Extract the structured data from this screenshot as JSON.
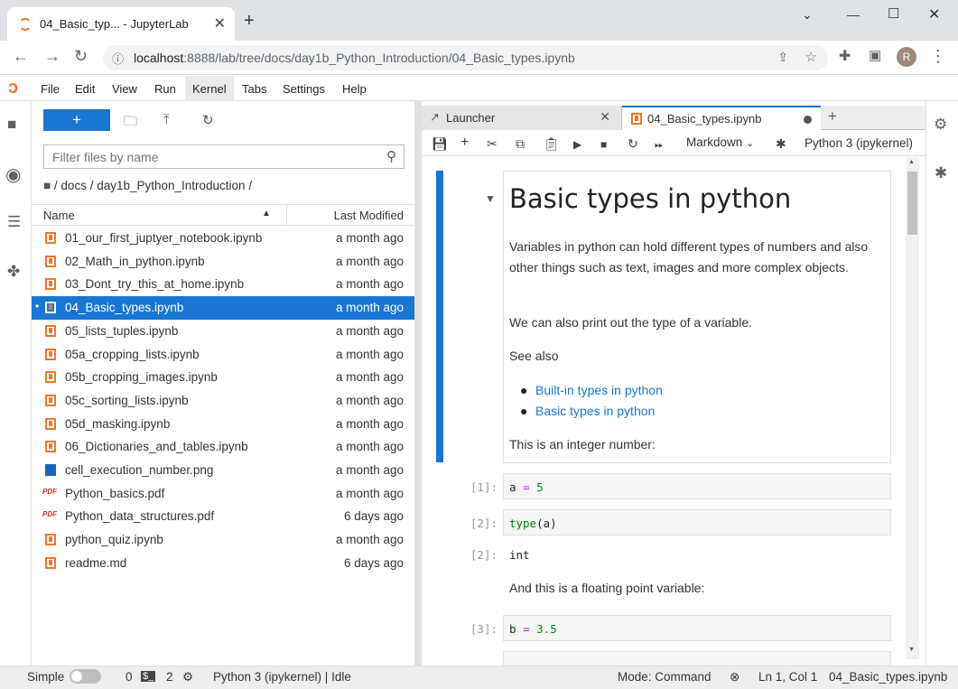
{
  "browser": {
    "tab_title": "04_Basic_typ... - JupyterLab",
    "url_host": "localhost",
    "url_rest": ":8888/lab/tree/docs/day1b_Python_Introduction/04_Basic_types.ipynb",
    "avatar": "R"
  },
  "menubar": [
    "File",
    "Edit",
    "View",
    "Run",
    "Kernel",
    "Tabs",
    "Settings",
    "Help"
  ],
  "filebrowser": {
    "filter_placeholder": "Filter files by name",
    "breadcrumb": "/ docs / day1b_Python_Introduction /",
    "col_name": "Name",
    "col_modified": "Last Modified",
    "files": [
      {
        "name": "01_our_first_juptyer_notebook.ipynb",
        "modified": "a month ago",
        "type": "notebook"
      },
      {
        "name": "02_Math_in_python.ipynb",
        "modified": "a month ago",
        "type": "notebook"
      },
      {
        "name": "03_Dont_try_this_at_home.ipynb",
        "modified": "a month ago",
        "type": "notebook"
      },
      {
        "name": "04_Basic_types.ipynb",
        "modified": "a month ago",
        "type": "notebook",
        "selected": true
      },
      {
        "name": "05_lists_tuples.ipynb",
        "modified": "a month ago",
        "type": "notebook"
      },
      {
        "name": "05a_cropping_lists.ipynb",
        "modified": "a month ago",
        "type": "notebook"
      },
      {
        "name": "05b_cropping_images.ipynb",
        "modified": "a month ago",
        "type": "notebook"
      },
      {
        "name": "05c_sorting_lists.ipynb",
        "modified": "a month ago",
        "type": "notebook"
      },
      {
        "name": "05d_masking.ipynb",
        "modified": "a month ago",
        "type": "notebook"
      },
      {
        "name": "06_Dictionaries_and_tables.ipynb",
        "modified": "a month ago",
        "type": "notebook"
      },
      {
        "name": "cell_execution_number.png",
        "modified": "a month ago",
        "type": "image"
      },
      {
        "name": "Python_basics.pdf",
        "modified": "a month ago",
        "type": "pdf"
      },
      {
        "name": "Python_data_structures.pdf",
        "modified": "6 days ago",
        "type": "pdf"
      },
      {
        "name": "python_quiz.ipynb",
        "modified": "a month ago",
        "type": "notebook"
      },
      {
        "name": "readme.md",
        "modified": "6 days ago",
        "type": "markdown"
      }
    ]
  },
  "tabs": {
    "launcher": "Launcher",
    "notebook": "04_Basic_types.ipynb"
  },
  "toolbar": {
    "cell_type": "Markdown",
    "kernel": "Python 3 (ipykernel)"
  },
  "notebook": {
    "heading": "Basic types in python",
    "para1": "Variables in python can hold different types of numbers and also other things such as text, images and more complex objects.",
    "para2": "We can also print out the type of a variable.",
    "para3": "See also",
    "links": [
      "Built-in types in python",
      "Basic types in python"
    ],
    "para4": "This is an integer number:",
    "cell1_prompt": "[1]:",
    "cell1_var": "a",
    "cell1_op": "=",
    "cell1_val": "5",
    "cell2_prompt": "[2]:",
    "cell2_fn": "type",
    "cell2_arg": "(a)",
    "out2_prompt": "[2]:",
    "out2": "int",
    "para5": "And this is a floating point variable:",
    "cell3_prompt": "[3]:",
    "cell3_var": "b",
    "cell3_op": "=",
    "cell3_val": "3.5"
  },
  "statusbar": {
    "simple": "Simple",
    "zero": "0",
    "two": "2",
    "kernel_status": "Python 3 (ipykernel) | Idle",
    "mode": "Mode: Command",
    "position": "Ln 1, Col 1",
    "filename": "04_Basic_types.ipynb"
  },
  "colors": {
    "accent": "#1976d2",
    "jupyter_orange": "#f37626"
  }
}
